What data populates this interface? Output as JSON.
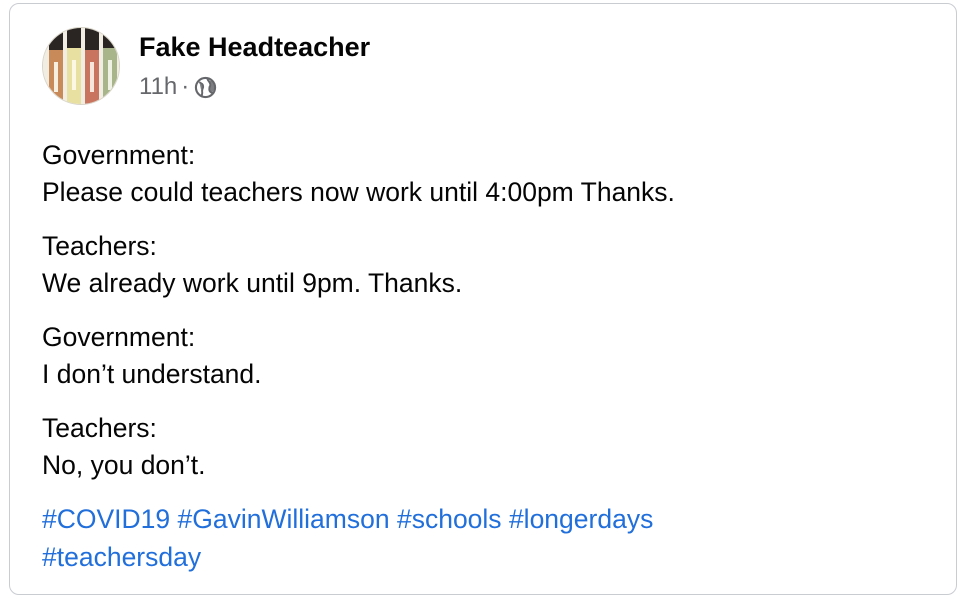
{
  "post": {
    "author": "Fake Headteacher",
    "timestamp": "11h",
    "separator": "·",
    "audience_icon": "globe-icon",
    "avatar_icon": "highlighter-pens-avatar",
    "paragraphs": [
      {
        "speaker": "Government:",
        "text": "Please could teachers now work until 4:00pm Thanks."
      },
      {
        "speaker": "Teachers:",
        "text": "We already work until 9pm. Thanks."
      },
      {
        "speaker": "Government:",
        "text": "I don’t understand."
      },
      {
        "speaker": "Teachers:",
        "text": "No, you don’t."
      }
    ],
    "hashtags": [
      "#COVID19",
      "#GavinWilliamson",
      "#schools",
      "#longerdays",
      "#teachersday"
    ]
  },
  "colors": {
    "text": "#050505",
    "meta": "#65676b",
    "link": "#216fdb",
    "border": "#c9ccd1"
  }
}
